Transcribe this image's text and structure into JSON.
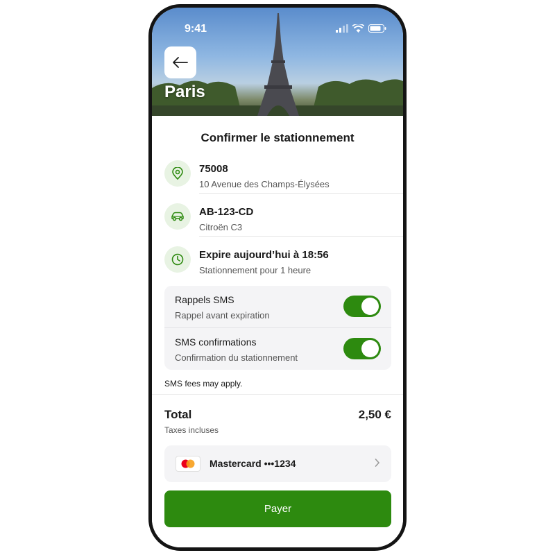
{
  "status_bar": {
    "time": "9:41"
  },
  "header": {
    "city": "Paris"
  },
  "page": {
    "title": "Confirmer le stationnement"
  },
  "location": {
    "postcode": "75008",
    "address": "10 Avenue des Champs-Élysées",
    "icon": "map-pin-icon"
  },
  "vehicle": {
    "plate": "AB-123-CD",
    "model": "Citroën C3",
    "icon": "car-icon"
  },
  "time": {
    "expiry": "Expire aujourd’hui à 18:56",
    "duration": "Stationnement pour 1 heure",
    "icon": "clock-icon"
  },
  "sms": {
    "reminders": {
      "title": "Rappels SMS",
      "subtitle": "Rappel avant expiration",
      "enabled": true
    },
    "confirmations": {
      "title": "SMS confirmations",
      "subtitle": "Confirmation du stationnement",
      "enabled": true
    },
    "fees_note": "SMS fees may apply."
  },
  "total": {
    "label": "Total",
    "amount": "2,50 €",
    "taxes": "Taxes incluses"
  },
  "payment": {
    "card_label": "Mastercard •••1234"
  },
  "pay_button": {
    "label": "Payer"
  },
  "colors": {
    "accent": "#2d8a0f",
    "icon_bg": "#e8f3e3",
    "panel_bg": "#f4f4f6"
  }
}
